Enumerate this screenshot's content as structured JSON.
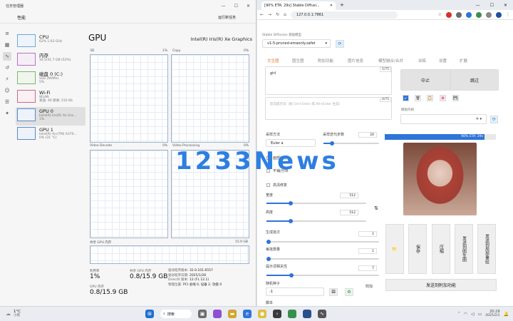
{
  "task_manager": {
    "title": "任务管理器",
    "header": "性能",
    "run_task": "运行新任务",
    "items": [
      {
        "name": "CPU",
        "sub": "62%  1.63 GHz"
      },
      {
        "name": "内存",
        "sub": "16.5/31.7 GB (52%)"
      },
      {
        "name": "磁盘 0 (C:)",
        "sub": "SSD (NVMe)",
        "sub2": "5%"
      },
      {
        "name": "Wi-Fi",
        "sub": "WLAN",
        "sub2": "发送: 40 接收: 232 Kb"
      },
      {
        "name": "GPU 0",
        "sub": "Intel(R) Iris(R) Xe Gra...",
        "sub2": "1%"
      },
      {
        "name": "GPU 1",
        "sub": "Intel(R) Arc(TM) A370...",
        "sub2": "0% (31 °C)"
      }
    ],
    "gpu_title": "GPU",
    "gpu_name": "Intel(R) Iris(R) Xe Graphics",
    "graph_labels": [
      "3D",
      "Copy",
      "Video Decode",
      "Video Processing"
    ],
    "graph_pcts": [
      "1%",
      "0%",
      "0%",
      "0%"
    ],
    "shared_label": "共享 GPU 内存",
    "shared_value": "15.9 GB",
    "utilization_label": "利用率",
    "utilization_value": "1%",
    "shared_mem_label": "共享 GPU 内存",
    "shared_mem_value": "0.8/15.9 GB",
    "gpu_mem_label": "GPU 内存",
    "gpu_mem_value": "0.8/15.9 GB",
    "driver_version_label": "驱动程序版本:",
    "driver_version": "32.0.101.6557",
    "driver_date_label": "驱动程序日期:",
    "driver_date": "2025/1/28",
    "directx_label": "DirectX 版本:",
    "directx": "12 (FL 12.1)",
    "location_label": "物理位置:",
    "location": "PCI 总线 0, 设备 2, 功能 0"
  },
  "browser": {
    "tab_title": "[90% ETA: 29s] Stable Diffusi...",
    "url": "127.0.0.1:7861",
    "sd_model_label": "Stable Diffusion 基础模型",
    "sd_model_value": "v1-5-pruned-emaonly.safet",
    "tabs": [
      "文生图",
      "图生图",
      "附加功能",
      "图片信息",
      "模型融合/合并",
      "训练",
      "设置",
      "扩展"
    ],
    "prompt_value": "girl",
    "prompt_count": "1/75",
    "neg_placeholder": "反向提示词（按 Ctrl+Enter 或 Alt+Enter 生成）",
    "neg_count": "0/75",
    "interrupt": "中止",
    "skip": "跳过",
    "styles_label": "模板风格",
    "sampler_label": "采样方法",
    "sampler_value": "Euler a",
    "steps_label": "采样迭代步数",
    "steps_value": "20",
    "face_fix": "面部修复",
    "tiling": "平铺/分块",
    "hires": "高清修复",
    "width_label": "宽度",
    "width_value": "512",
    "height_label": "高度",
    "height_value": "512",
    "batch_count_label": "生成批次",
    "batch_count_value": "1",
    "batch_size_label": "每批数量",
    "batch_size_value": "1",
    "cfg_label": "提示词相关性",
    "cfg_value": "7",
    "seed_label": "随机种子",
    "seed_value": "-1",
    "extra_label": "附加",
    "script_label": "脚本",
    "progress_text": "90% ETA: 29s",
    "progress": 0.9,
    "actions": [
      "保存",
      "压缩",
      "发送到图生图",
      "发送到局部重绘"
    ],
    "send_extras": "发送到附加功能"
  },
  "watermark": "1233News",
  "taskbar": {
    "temp": "1°C",
    "weather": "小雨",
    "time": "20:29",
    "date": "2025/2/1",
    "search": "搜索"
  }
}
